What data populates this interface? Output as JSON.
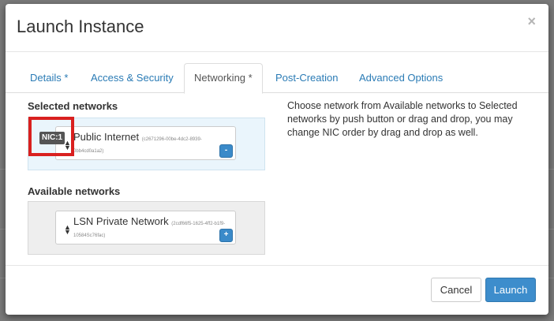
{
  "modal": {
    "title": "Launch Instance",
    "close_glyph": "×"
  },
  "tabs": [
    {
      "label": "Details *",
      "active": false
    },
    {
      "label": "Access & Security",
      "active": false
    },
    {
      "label": "Networking *",
      "active": true
    },
    {
      "label": "Post-Creation",
      "active": false
    },
    {
      "label": "Advanced Options",
      "active": false
    }
  ],
  "selected_networks": {
    "heading": "Selected networks",
    "items": [
      {
        "nic_label": "NIC:1",
        "name": "Public Internet",
        "id_part1": "(c2671296-00be-4dc2-8939-",
        "id_part2": "0bb4cd0a1a2)",
        "action": "-"
      }
    ]
  },
  "available_networks": {
    "heading": "Available networks",
    "items": [
      {
        "name": "LSN Private Network",
        "id_part1": "(2cdf66f5-1625-4ff2-b1f9-",
        "id_part2": "10584Sc76fac)",
        "action": "+"
      }
    ]
  },
  "help_text": "Choose network from Available networks to Selected networks by push button or drag and drop, you may change NIC order by drag and drop as well.",
  "footer": {
    "cancel_label": "Cancel",
    "launch_label": "Launch"
  },
  "colors": {
    "accent": "#3d8dcc",
    "link": "#2a7bb5",
    "highlight": "#d9201f"
  }
}
